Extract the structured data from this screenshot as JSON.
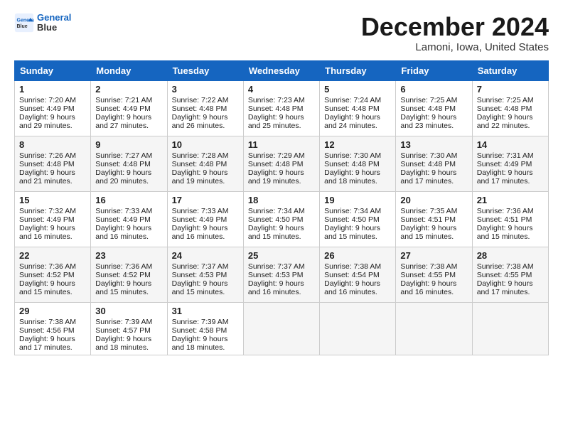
{
  "header": {
    "logo_line1": "General",
    "logo_line2": "Blue",
    "month": "December 2024",
    "location": "Lamoni, Iowa, United States"
  },
  "weekdays": [
    "Sunday",
    "Monday",
    "Tuesday",
    "Wednesday",
    "Thursday",
    "Friday",
    "Saturday"
  ],
  "weeks": [
    [
      {
        "day": "1",
        "rise": "Sunrise: 7:20 AM",
        "set": "Sunset: 4:49 PM",
        "light": "Daylight: 9 hours and 29 minutes."
      },
      {
        "day": "2",
        "rise": "Sunrise: 7:21 AM",
        "set": "Sunset: 4:49 PM",
        "light": "Daylight: 9 hours and 27 minutes."
      },
      {
        "day": "3",
        "rise": "Sunrise: 7:22 AM",
        "set": "Sunset: 4:48 PM",
        "light": "Daylight: 9 hours and 26 minutes."
      },
      {
        "day": "4",
        "rise": "Sunrise: 7:23 AM",
        "set": "Sunset: 4:48 PM",
        "light": "Daylight: 9 hours and 25 minutes."
      },
      {
        "day": "5",
        "rise": "Sunrise: 7:24 AM",
        "set": "Sunset: 4:48 PM",
        "light": "Daylight: 9 hours and 24 minutes."
      },
      {
        "day": "6",
        "rise": "Sunrise: 7:25 AM",
        "set": "Sunset: 4:48 PM",
        "light": "Daylight: 9 hours and 23 minutes."
      },
      {
        "day": "7",
        "rise": "Sunrise: 7:25 AM",
        "set": "Sunset: 4:48 PM",
        "light": "Daylight: 9 hours and 22 minutes."
      }
    ],
    [
      {
        "day": "8",
        "rise": "Sunrise: 7:26 AM",
        "set": "Sunset: 4:48 PM",
        "light": "Daylight: 9 hours and 21 minutes."
      },
      {
        "day": "9",
        "rise": "Sunrise: 7:27 AM",
        "set": "Sunset: 4:48 PM",
        "light": "Daylight: 9 hours and 20 minutes."
      },
      {
        "day": "10",
        "rise": "Sunrise: 7:28 AM",
        "set": "Sunset: 4:48 PM",
        "light": "Daylight: 9 hours and 19 minutes."
      },
      {
        "day": "11",
        "rise": "Sunrise: 7:29 AM",
        "set": "Sunset: 4:48 PM",
        "light": "Daylight: 9 hours and 19 minutes."
      },
      {
        "day": "12",
        "rise": "Sunrise: 7:30 AM",
        "set": "Sunset: 4:48 PM",
        "light": "Daylight: 9 hours and 18 minutes."
      },
      {
        "day": "13",
        "rise": "Sunrise: 7:30 AM",
        "set": "Sunset: 4:48 PM",
        "light": "Daylight: 9 hours and 17 minutes."
      },
      {
        "day": "14",
        "rise": "Sunrise: 7:31 AM",
        "set": "Sunset: 4:49 PM",
        "light": "Daylight: 9 hours and 17 minutes."
      }
    ],
    [
      {
        "day": "15",
        "rise": "Sunrise: 7:32 AM",
        "set": "Sunset: 4:49 PM",
        "light": "Daylight: 9 hours and 16 minutes."
      },
      {
        "day": "16",
        "rise": "Sunrise: 7:33 AM",
        "set": "Sunset: 4:49 PM",
        "light": "Daylight: 9 hours and 16 minutes."
      },
      {
        "day": "17",
        "rise": "Sunrise: 7:33 AM",
        "set": "Sunset: 4:49 PM",
        "light": "Daylight: 9 hours and 16 minutes."
      },
      {
        "day": "18",
        "rise": "Sunrise: 7:34 AM",
        "set": "Sunset: 4:50 PM",
        "light": "Daylight: 9 hours and 15 minutes."
      },
      {
        "day": "19",
        "rise": "Sunrise: 7:34 AM",
        "set": "Sunset: 4:50 PM",
        "light": "Daylight: 9 hours and 15 minutes."
      },
      {
        "day": "20",
        "rise": "Sunrise: 7:35 AM",
        "set": "Sunset: 4:51 PM",
        "light": "Daylight: 9 hours and 15 minutes."
      },
      {
        "day": "21",
        "rise": "Sunrise: 7:36 AM",
        "set": "Sunset: 4:51 PM",
        "light": "Daylight: 9 hours and 15 minutes."
      }
    ],
    [
      {
        "day": "22",
        "rise": "Sunrise: 7:36 AM",
        "set": "Sunset: 4:52 PM",
        "light": "Daylight: 9 hours and 15 minutes."
      },
      {
        "day": "23",
        "rise": "Sunrise: 7:36 AM",
        "set": "Sunset: 4:52 PM",
        "light": "Daylight: 9 hours and 15 minutes."
      },
      {
        "day": "24",
        "rise": "Sunrise: 7:37 AM",
        "set": "Sunset: 4:53 PM",
        "light": "Daylight: 9 hours and 15 minutes."
      },
      {
        "day": "25",
        "rise": "Sunrise: 7:37 AM",
        "set": "Sunset: 4:53 PM",
        "light": "Daylight: 9 hours and 16 minutes."
      },
      {
        "day": "26",
        "rise": "Sunrise: 7:38 AM",
        "set": "Sunset: 4:54 PM",
        "light": "Daylight: 9 hours and 16 minutes."
      },
      {
        "day": "27",
        "rise": "Sunrise: 7:38 AM",
        "set": "Sunset: 4:55 PM",
        "light": "Daylight: 9 hours and 16 minutes."
      },
      {
        "day": "28",
        "rise": "Sunrise: 7:38 AM",
        "set": "Sunset: 4:55 PM",
        "light": "Daylight: 9 hours and 17 minutes."
      }
    ],
    [
      {
        "day": "29",
        "rise": "Sunrise: 7:38 AM",
        "set": "Sunset: 4:56 PM",
        "light": "Daylight: 9 hours and 17 minutes."
      },
      {
        "day": "30",
        "rise": "Sunrise: 7:39 AM",
        "set": "Sunset: 4:57 PM",
        "light": "Daylight: 9 hours and 18 minutes."
      },
      {
        "day": "31",
        "rise": "Sunrise: 7:39 AM",
        "set": "Sunset: 4:58 PM",
        "light": "Daylight: 9 hours and 18 minutes."
      },
      null,
      null,
      null,
      null
    ]
  ]
}
